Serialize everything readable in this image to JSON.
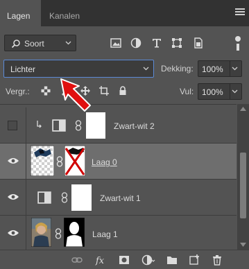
{
  "tabs": [
    {
      "label": "Lagen",
      "active": true
    },
    {
      "label": "Kanalen",
      "active": false
    }
  ],
  "filter": {
    "kind_label": "Soort",
    "icons": [
      "image-filter-icon",
      "adjustment-filter-icon",
      "type-filter-icon",
      "shape-filter-icon",
      "smart-object-filter-icon"
    ]
  },
  "blend": {
    "mode": "Lichter",
    "opacity_label": "Dekking:",
    "opacity_value": "100%"
  },
  "lock": {
    "label": "Vergr.:",
    "fill_label": "Vul:",
    "fill_value": "100%"
  },
  "layers": [
    {
      "name": "Zwart-wit 2",
      "visible": false,
      "clipped": true,
      "type": "adjustment"
    },
    {
      "name": "Laag 0",
      "visible": true,
      "selected": true,
      "type": "pixel-with-mask"
    },
    {
      "name": "Zwart-wit 1",
      "visible": true,
      "type": "adjustment"
    },
    {
      "name": "Laag 1",
      "visible": true,
      "type": "pixel-with-mask"
    }
  ],
  "colors": {
    "panel": "#535353",
    "tabbar": "#323232",
    "selected_row": "#6e6e6e",
    "focus_border": "#5b8ad6",
    "annotation_arrow": "#e01010"
  }
}
